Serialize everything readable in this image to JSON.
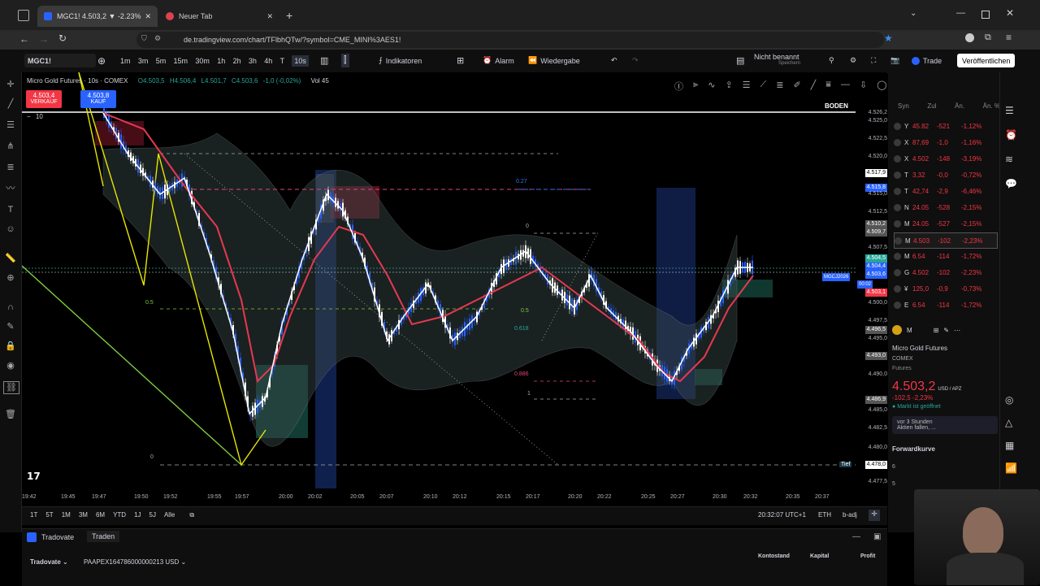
{
  "browser": {
    "tab1_title": "MGC1! 4.503,2 ▼ -2.23% Nicht",
    "tab2_title": "Neuer Tab",
    "url": "de.tradingview.com/chart/TFlbhQTw/?symbol=CME_MINI%3AES1!"
  },
  "toolbar": {
    "symbol": "MGC1!",
    "intervals": [
      "1m",
      "3m",
      "5m",
      "15m",
      "30m",
      "1h",
      "2h",
      "3h",
      "4h",
      "T",
      "10s"
    ],
    "indicators": "Indikatoren",
    "alarm": "Alarm",
    "replay": "Wiedergabe",
    "layout_name": "Nicht benannt",
    "layout_sub": "Speichern",
    "trade": "Trade",
    "publish": "Veröffentlichen"
  },
  "chart": {
    "legend_title": "Micro Gold Futures · 10s · COMEX",
    "ohlc": {
      "o": "O4.503,5",
      "h": "H4.506,4",
      "l": "L4.501,7",
      "c": "C4.503,6",
      "chg": "-1,0 (-0,02%)",
      "vol": "Vol 45"
    },
    "sell_price": "4.503,4",
    "sell_label": "VERKAUF",
    "buy_price": "4.503,8",
    "buy_label": "KAUF",
    "qty": "10",
    "boden_label": "BODEN",
    "tief_label": "Tief",
    "price_axis": [
      "4.526,2",
      "4.525,0",
      "4.522,5",
      "4.520,0",
      "4.517,9",
      "4.515,8",
      "4.515,0",
      "4.512,5",
      "4.510,2",
      "4.509,7",
      "4.507,5",
      "4.504,5",
      "4.504,4",
      "4.503,6",
      "4.503,1",
      "4.500,0",
      "4.497,5",
      "4.496,5",
      "4.495,0",
      "4.493,0",
      "4.490,0",
      "4.486,9",
      "4.485,0",
      "4.482,5",
      "4.480,0",
      "4.478,0",
      "4.477,5"
    ],
    "contract_tag": "MGCJ2026",
    "countdown": "00:02",
    "time_axis": [
      "19:42",
      "19:45",
      "19:47",
      "19:50",
      "19:52",
      "19:55",
      "19:57",
      "20:00",
      "20:02",
      "20:05",
      "20:07",
      "20:10",
      "20:12",
      "20:15",
      "20:17",
      "20:20",
      "20:22",
      "20:25",
      "20:27",
      "20:30",
      "20:32",
      "20:35",
      "20:37"
    ],
    "fib_labels": [
      "0.27",
      "0.5",
      "0",
      "0.618",
      "0.886",
      "1",
      "0.5",
      "0.618",
      "0",
      "0.5"
    ]
  },
  "bottom_bar": {
    "ranges": [
      "1T",
      "5T",
      "1M",
      "3M",
      "6M",
      "YTD",
      "1J",
      "5J",
      "Alle"
    ],
    "clock": "20:32:07 UTC+1",
    "session": "ETH",
    "adj": "b-adj"
  },
  "trading_panel": {
    "broker": "Tradovate",
    "trade_btn": "Traden",
    "account": "PAAPEX164786000000213 USD",
    "broker2": "Tradovate",
    "cols": [
      "Kontostand",
      "Kapital",
      "Profit"
    ]
  },
  "watchlist": {
    "headers": [
      "Syn",
      "Zul",
      "Än.",
      "Än. %"
    ],
    "rows": [
      {
        "sym": "Y",
        "last": "45.82",
        "chg": "-521",
        "pct": "-1,12%",
        "color": "#f23645"
      },
      {
        "sym": "X",
        "last": "87,69",
        "chg": "-1,0",
        "pct": "-1,16%",
        "color": "#f23645"
      },
      {
        "sym": "X",
        "last": "4.502",
        "chg": "-148",
        "pct": "-3,19%",
        "color": "#f23645"
      },
      {
        "sym": "T",
        "last": "3,32",
        "chg": "-0,0",
        "pct": "-0,72%",
        "color": "#f23645"
      },
      {
        "sym": "T",
        "last": "42,74",
        "chg": "-2,9",
        "pct": "-6,46%",
        "color": "#f23645"
      },
      {
        "sym": "N",
        "last": "24.05",
        "chg": "-528",
        "pct": "-2,15%",
        "color": "#f23645"
      },
      {
        "sym": "M",
        "last": "24.05",
        "chg": "-527",
        "pct": "-2,15%",
        "color": "#f23645"
      },
      {
        "sym": "M",
        "last": "4.503",
        "chg": "-102",
        "pct": "-2,23%",
        "color": "#f23645"
      },
      {
        "sym": "M",
        "last": "6.54",
        "chg": "-114",
        "pct": "-1,72%",
        "color": "#f23645"
      },
      {
        "sym": "G",
        "last": "4.502",
        "chg": "-102",
        "pct": "-2,23%",
        "color": "#f23645"
      },
      {
        "sym": "¥",
        "last": "125,0",
        "chg": "-0,9",
        "pct": "-0,73%",
        "color": "#f23645"
      },
      {
        "sym": "E",
        "last": "6.54",
        "chg": "-114",
        "pct": "-1,72%",
        "color": "#f23645"
      }
    ]
  },
  "details": {
    "sym": "M",
    "name": "Micro Gold Futures",
    "exchange": "COMEX",
    "category": "Futures",
    "price": "4.503,2",
    "currency": "USD / APZ",
    "change": "-102,5 -2,23%",
    "status": "Markt ist geöffnet",
    "news_time": "vor 3 Stunden",
    "news_text": "Aktien fallen, ...",
    "forward": "Forwardkurve",
    "axis_6": "6",
    "axis_5": "5"
  },
  "colors": {
    "up": "#26a69a",
    "down": "#f23645",
    "accent": "#2962ff",
    "ma_red": "#e53950",
    "ma_white": "#ffffff",
    "zigzag": "#e6e600",
    "trend": "#7ecb3e"
  }
}
